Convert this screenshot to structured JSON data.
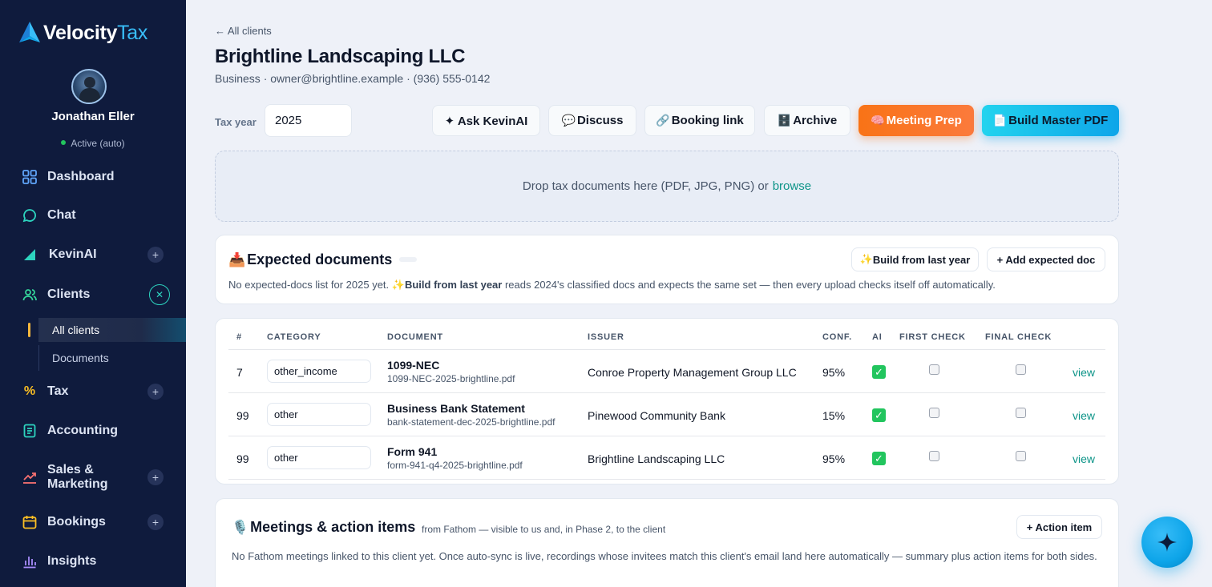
{
  "brand": {
    "name_main": "Velocity",
    "name_accent": "Tax"
  },
  "user": {
    "name": "Jonathan Eller",
    "status": "Active (auto)"
  },
  "nav": {
    "dashboard": "Dashboard",
    "chat": "Chat",
    "kevinai": "KevinAI",
    "clients": "Clients",
    "clients_sub": [
      "All clients",
      "Documents"
    ],
    "tax": "Tax",
    "accounting": "Accounting",
    "sales_marketing": "Sales &\nMarketing",
    "bookings": "Bookings",
    "insights": "Insights"
  },
  "header": {
    "back": "← All clients",
    "title": "Brightline Landscaping LLC",
    "subtitle": "Business · owner@brightline.example · (936) 555-0142"
  },
  "toolbar": {
    "tax_year_label": "Tax year",
    "tax_year_value": "2025",
    "ask": "✦ Ask KevinAI",
    "discuss": "Discuss",
    "booking": "Booking link",
    "archive": "Archive",
    "meeting_prep": "Meeting Prep",
    "build_pdf": "Build Master PDF"
  },
  "dropzone": {
    "text": "Drop tax documents here (PDF, JPG, PNG) or",
    "link": "browse"
  },
  "expected": {
    "title": "Expected documents",
    "build_btn": "Build from last year",
    "add_btn": "+ Add expected doc",
    "desc_pre": "No expected-docs list for 2025 yet. ✨",
    "desc_bold": "Build from last year",
    "desc_post": " reads 2024's classified docs and expects the same set — then every upload checks itself off automatically."
  },
  "table": {
    "headers": [
      "#",
      "CATEGORY",
      "DOCUMENT",
      "ISSUER",
      "CONF.",
      "AI",
      "FIRST CHECK",
      "FINAL CHECK"
    ],
    "rows": [
      {
        "num": "7",
        "category": "other_income",
        "doc": "1099-NEC",
        "file": "1099-NEC-2025-brightline.pdf",
        "issuer": "Conroe Property Management Group LLC",
        "conf": "95%",
        "view": "view"
      },
      {
        "num": "99",
        "category": "other",
        "doc": "Business Bank Statement",
        "file": "bank-statement-dec-2025-brightline.pdf",
        "issuer": "Pinewood Community Bank",
        "conf": "15%",
        "view": "view"
      },
      {
        "num": "99",
        "category": "other",
        "doc": "Form 941",
        "file": "form-941-q4-2025-brightline.pdf",
        "issuer": "Brightline Landscaping LLC",
        "conf": "95%",
        "view": "view"
      }
    ]
  },
  "meetings": {
    "title": "Meetings & action items",
    "sub": "from Fathom — visible to us and, in Phase 2, to the client",
    "action_btn": "+ Action item",
    "desc": "No Fathom meetings linked to this client yet. Once auto-sync is live, recordings whose invitees match this client's email land here automatically — summary plus action items for both sides."
  },
  "colors": {
    "sidebar": "#0f1b3d",
    "accent_teal": "#0d9488",
    "orange": "#f97316",
    "cyan": "#22d3ee"
  }
}
